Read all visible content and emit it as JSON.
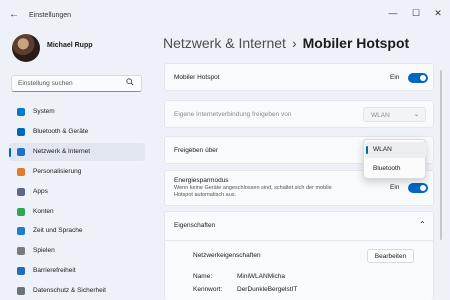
{
  "window": {
    "back_glyph": "←",
    "title": "Einstellungen",
    "controls": {
      "minimize": "—",
      "maximize": "☐",
      "close": "✕"
    }
  },
  "profile": {
    "name": "Michael Rupp"
  },
  "search": {
    "placeholder": "Einstellung suchen",
    "icon": "search-icon"
  },
  "sidebar": {
    "items": [
      {
        "label": "System",
        "icon": "system-icon",
        "color": "#0078d4"
      },
      {
        "label": "Bluetooth & Geräte",
        "icon": "bluetooth-icon",
        "color": "#0067c0"
      },
      {
        "label": "Netzwerk & Internet",
        "icon": "wifi-icon",
        "color": "#1a73c9",
        "active": true
      },
      {
        "label": "Personalisierung",
        "icon": "brush-icon",
        "color": "#e07a2e"
      },
      {
        "label": "Apps",
        "icon": "apps-icon",
        "color": "#5a6a86"
      },
      {
        "label": "Konten",
        "icon": "account-icon",
        "color": "#2ea84f"
      },
      {
        "label": "Zeit und Sprache",
        "icon": "clock-globe-icon",
        "color": "#1a7fd1"
      },
      {
        "label": "Spielen",
        "icon": "gamepad-icon",
        "color": "#7a7a7a"
      },
      {
        "label": "Barrierefreiheit",
        "icon": "accessibility-icon",
        "color": "#1f6fb8"
      },
      {
        "label": "Datenschutz & Sicherheit",
        "icon": "shield-icon",
        "color": "#6b7280"
      }
    ]
  },
  "header": {
    "crumb": "Netzwerk & Internet",
    "separator": "›",
    "current": "Mobiler Hotspot"
  },
  "hotspot": {
    "label": "Mobiler Hotspot",
    "state": "Ein"
  },
  "share_connection": {
    "label": "Eigene Internetverbindung freigeben von",
    "value": "WLAN",
    "chevron": "⌄"
  },
  "share_over": {
    "label": "Freigeben über",
    "options": [
      "WLAN",
      "Bluetooth"
    ],
    "selected": "WLAN"
  },
  "energy": {
    "label": "Energiesparmodus",
    "description": "Wenn keine Geräte angeschlossen sind, schaltet sich der mobile Hotspot automatisch aus.",
    "state": "Ein"
  },
  "properties": {
    "title": "Eigenschaften",
    "chevron": "⌃",
    "network_title": "Netzwerkeigenschaften",
    "edit_button": "Bearbeiten",
    "fields": [
      {
        "key": "Name:",
        "value": "MiniWLANMicha"
      },
      {
        "key": "Kennwort:",
        "value": "DerDunkleBergelstIT"
      }
    ]
  },
  "colors": {
    "accent": "#0067c0"
  }
}
